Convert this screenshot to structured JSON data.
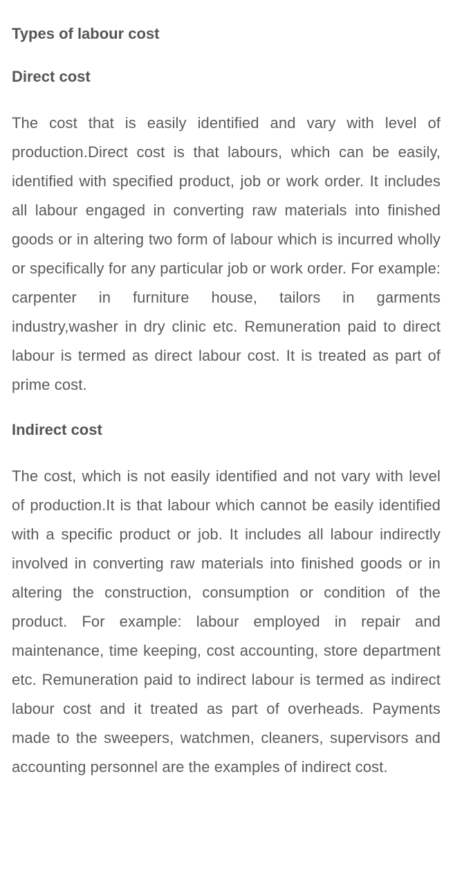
{
  "article": {
    "title": "Types of labour cost",
    "sections": [
      {
        "heading": "Direct cost",
        "body": "The cost that is easily identified and vary with level of production.Direct cost is that labours, which can be easily, identified with specified product, job or work order. It includes all labour engaged in converting raw materials into finished goods or in altering two form of labour which is incurred wholly or specifically for any particular job or work order. For example: carpenter in furniture house, tailors in garments industry,washer in dry clinic etc. Remuneration paid to direct labour is termed as direct labour cost. It is treated as part of prime cost."
      },
      {
        "heading": "Indirect cost",
        "body": "The cost, which is not easily identified and not vary with level of production.It is that labour which cannot be easily identified with a specific product or job. It includes all labour indirectly involved in converting raw materials into finished goods or in altering the construction, consumption or condition of the product. For example: labour employed in repair and maintenance, time keeping, cost accounting, store department etc. Remuneration paid to indirect labour is termed as indirect labour cost and it treated as part of overheads. Payments made to the sweepers, watchmen, cleaners, supervisors and accounting personnel are the examples of indirect cost."
      }
    ]
  },
  "colors": {
    "text": "#555555",
    "background": "#ffffff"
  }
}
